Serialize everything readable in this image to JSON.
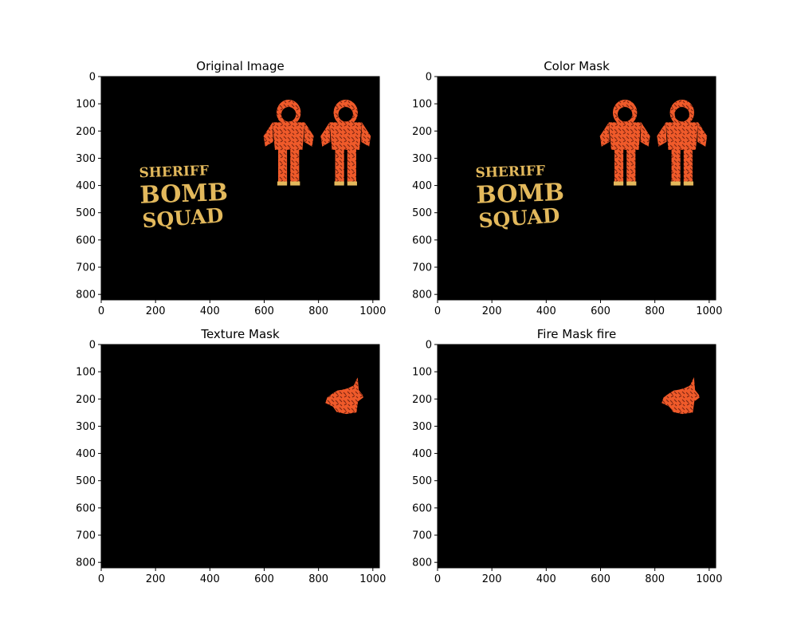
{
  "chart_data": [
    {
      "type": "image",
      "title": "Original Image",
      "xlim": [
        0,
        1024
      ],
      "ylim": [
        820,
        0
      ],
      "xticks": [
        0,
        200,
        400,
        600,
        800,
        1000
      ],
      "yticks": [
        0,
        100,
        200,
        300,
        400,
        500,
        600,
        700,
        800
      ],
      "grid": false,
      "content": {
        "background": "#000000",
        "text_lines": [
          "SHERIFF",
          "BOMB",
          "SQUAD"
        ],
        "text_color": "#e3b95c",
        "suit_color": "#ef5a2a",
        "figures": [
          {
            "name": "suit-left",
            "center_x": 690,
            "top_y": 85,
            "bottom_y": 400
          },
          {
            "name": "suit-right",
            "center_x": 900,
            "top_y": 85,
            "bottom_y": 400
          }
        ]
      }
    },
    {
      "type": "image",
      "title": "Color Mask",
      "xlim": [
        0,
        1024
      ],
      "ylim": [
        820,
        0
      ],
      "xticks": [
        0,
        200,
        400,
        600,
        800,
        1000
      ],
      "yticks": [
        0,
        100,
        200,
        300,
        400,
        500,
        600,
        700,
        800
      ],
      "grid": false,
      "content": {
        "background": "#000000",
        "text_lines": [
          "SHERIFF",
          "BOMB",
          "SQUAD"
        ],
        "text_color": "#e3b95c",
        "suit_color": "#ef5a2a",
        "figures": [
          {
            "name": "suit-left",
            "center_x": 690,
            "top_y": 85,
            "bottom_y": 400
          },
          {
            "name": "suit-right",
            "center_x": 900,
            "top_y": 85,
            "bottom_y": 400
          }
        ]
      }
    },
    {
      "type": "image",
      "title": "Texture Mask",
      "xlim": [
        0,
        1024
      ],
      "ylim": [
        820,
        0
      ],
      "xticks": [
        0,
        200,
        400,
        600,
        800,
        1000
      ],
      "yticks": [
        0,
        100,
        200,
        300,
        400,
        500,
        600,
        700,
        800
      ],
      "grid": false,
      "content": {
        "background": "#000000",
        "suit_color": "#ef5a2a",
        "blob": {
          "center_x": 895,
          "center_y": 195,
          "x_range": [
            825,
            965
          ],
          "y_range": [
            120,
            255
          ]
        }
      }
    },
    {
      "type": "image",
      "title": "Fire Mask fire",
      "xlim": [
        0,
        1024
      ],
      "ylim": [
        820,
        0
      ],
      "xticks": [
        0,
        200,
        400,
        600,
        800,
        1000
      ],
      "yticks": [
        0,
        100,
        200,
        300,
        400,
        500,
        600,
        700,
        800
      ],
      "grid": false,
      "content": {
        "background": "#000000",
        "suit_color": "#ef5a2a",
        "blob": {
          "center_x": 895,
          "center_y": 195,
          "x_range": [
            825,
            965
          ],
          "y_range": [
            120,
            255
          ]
        }
      }
    }
  ]
}
